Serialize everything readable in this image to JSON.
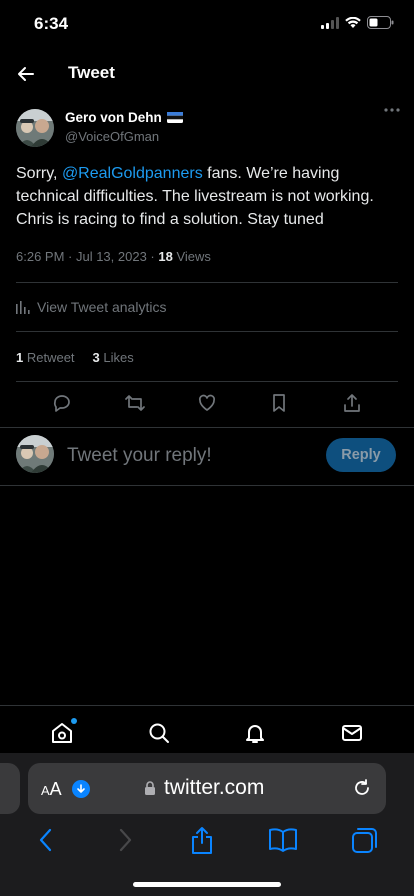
{
  "status_bar": {
    "time": "6:34"
  },
  "header": {
    "title": "Tweet"
  },
  "tweet": {
    "author_name": "Gero von Dehn",
    "author_handle": "@VoiceOfGman",
    "text_before": "Sorry, ",
    "mention": "@RealGoldpanners",
    "text_after": " fans.  We’re having technical difficulties.  The livestream is not working.  Chris is racing to find a solution.  Stay tuned",
    "timestamp": "6:26 PM · Jul 13, 2023 · ",
    "views_count": "18",
    "views_label": " Views",
    "analytics_label": "View Tweet analytics",
    "retweets_count": "1",
    "retweets_label": " Retweet",
    "likes_count": "3",
    "likes_label": " Likes"
  },
  "reply": {
    "placeholder": "Tweet your reply!",
    "button_label": "Reply"
  },
  "browser": {
    "aa_label_small": "A",
    "aa_label": "A",
    "url": "twitter.com"
  },
  "colors": {
    "accent": "#1d9bf0",
    "background": "#000000"
  }
}
